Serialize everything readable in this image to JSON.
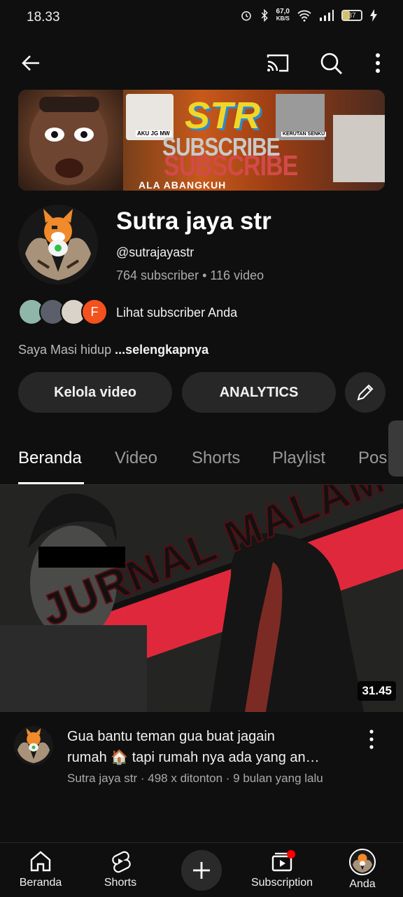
{
  "status_bar": {
    "time": "18.33",
    "net_speed": "67,0",
    "net_unit": "KB/S",
    "battery": "37"
  },
  "app_bar": {
    "back_icon": "arrow-left-icon",
    "cast_icon": "cast-icon",
    "search_icon": "search-icon",
    "more_icon": "more-vertical-icon"
  },
  "banner": {
    "text_str": "STR",
    "text_subscribe1": "SUBSCRIBE",
    "text_subscribe2": "SUBSCRIBE",
    "text_ala": "ALA ABANGKUH",
    "text_aku": "AKU JG MW",
    "text_kerutan": "KERUTAN SENKU"
  },
  "channel": {
    "name": "Sutra jaya str",
    "handle": "@sutrajayastr",
    "stats": "764 subscriber • 116 video",
    "subscribers_label": "Lihat subscriber Anda",
    "subscriber_initial": "F",
    "description": "Saya Masi hidup ",
    "description_more": "...selengkapnya"
  },
  "actions": {
    "manage_videos": "Kelola video",
    "analytics": "ANALYTICS"
  },
  "tabs": [
    "Beranda",
    "Video",
    "Shorts",
    "Playlist",
    "Pos"
  ],
  "active_tab": "Beranda",
  "video": {
    "thumbnail_text": "JURNAL MALAM",
    "duration": "31.45",
    "title_line1": "Gua bantu teman gua buat jagain",
    "title_line2": "rumah 🏠 tapi rumah nya ada yang an…",
    "meta": "Sutra jaya str · 498 x ditonton · 9 bulan yang lalu"
  },
  "bottom_nav": {
    "home": "Beranda",
    "shorts": "Shorts",
    "subscriptions": "Subscription",
    "you": "Anda"
  },
  "colors": {
    "background": "#0f0f0f",
    "chip": "#272727",
    "accent_red": "#ff0000",
    "subscriber_f": "#f4511e"
  }
}
